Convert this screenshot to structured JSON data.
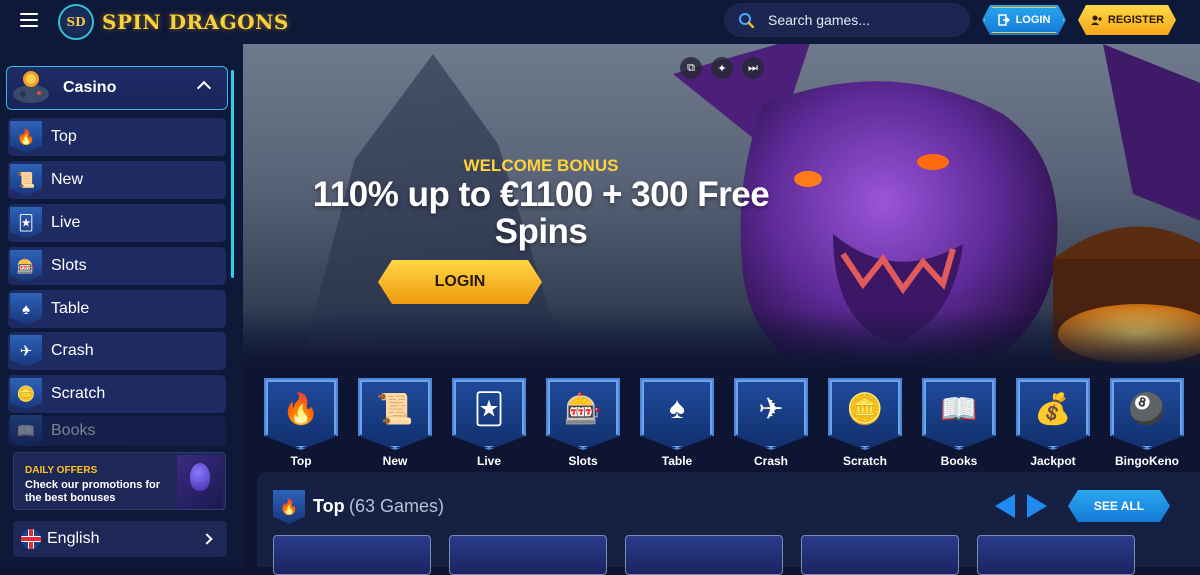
{
  "header": {
    "logo_badge": "SD",
    "logo_text": "SPIN DRAGONS",
    "search_placeholder": "Search games...",
    "login_label": "LOGIN",
    "register_label": "REGISTER"
  },
  "sidebar": {
    "section_title": "Casino",
    "items": [
      {
        "label": "Top",
        "icon": "flame-icon"
      },
      {
        "label": "New",
        "icon": "scroll-icon"
      },
      {
        "label": "Live",
        "icon": "cards-icon"
      },
      {
        "label": "Slots",
        "icon": "slot-machine-icon"
      },
      {
        "label": "Table",
        "icon": "table-cards-icon"
      },
      {
        "label": "Crash",
        "icon": "plane-icon"
      },
      {
        "label": "Scratch",
        "icon": "coin-icon"
      },
      {
        "label": "Books",
        "icon": "book-icon"
      }
    ],
    "offers": {
      "title": "DAILY OFFERS",
      "description": "Check our promotions for the best bonuses"
    },
    "language": "English"
  },
  "hero": {
    "kicker": "WELCOME BONUS",
    "headline": "110% up to €1100 + 300 Free Spins",
    "cta_label": "LOGIN"
  },
  "categories": [
    {
      "label": "Top",
      "glyph": "🔥"
    },
    {
      "label": "New",
      "glyph": "📜"
    },
    {
      "label": "Live",
      "glyph": "🃏"
    },
    {
      "label": "Slots",
      "glyph": "🎰"
    },
    {
      "label": "Table",
      "glyph": "♠"
    },
    {
      "label": "Crash",
      "glyph": "✈"
    },
    {
      "label": "Scratch",
      "glyph": "🪙"
    },
    {
      "label": "Books",
      "glyph": "📖"
    },
    {
      "label": "Jackpot",
      "glyph": "💰"
    },
    {
      "label": "BingoKeno",
      "glyph": "🎱"
    }
  ],
  "top_section": {
    "title": "Top",
    "count": "(63 Games)",
    "see_all_label": "SEE ALL"
  },
  "colors": {
    "accent_blue": "#1f8af0",
    "accent_gold": "#ffd23b",
    "background": "#0d1533"
  }
}
